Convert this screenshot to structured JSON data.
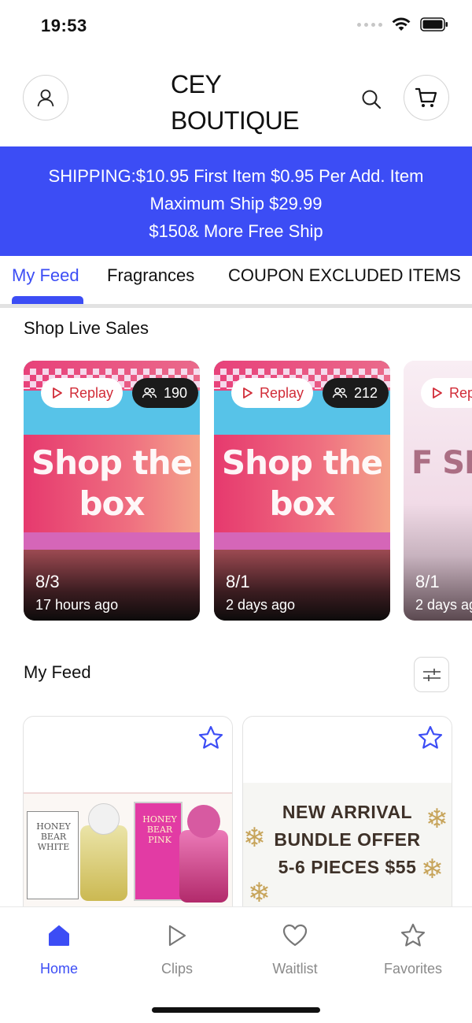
{
  "status_bar": {
    "time": "19:53"
  },
  "header": {
    "brand": "CEY\nBOUTIQUE"
  },
  "banner": {
    "lines": [
      "SHIPPING:$10.95 First Item $0.95  Per Add. Item",
      "Maximum Ship $29.99",
      "$150& More Free Ship"
    ],
    "background": "#3c4df5"
  },
  "tabs": [
    {
      "label": "My Feed",
      "active": true
    },
    {
      "label": "Fragrances",
      "active": false
    },
    {
      "label": "COUPON EXCLUDED ITEMS",
      "active": false
    }
  ],
  "live_section": {
    "title": "Shop Live Sales",
    "cards": [
      {
        "replay": "Replay",
        "viewers": "190",
        "headline": "Shop the box",
        "date": "8/3",
        "ago": "17 hours ago"
      },
      {
        "replay": "Replay",
        "viewers": "212",
        "headline": "Shop the box",
        "date": "8/1",
        "ago": "2 days ago"
      },
      {
        "replay": "Rep",
        "headline": "F SHI",
        "date": "8/1",
        "ago": "2 days ag"
      }
    ]
  },
  "feed_section": {
    "title": "My Feed",
    "products": [
      {
        "box_labels": [
          "HONEY BEAR WHITE",
          "HONEY BEAR PINK"
        ]
      },
      {
        "lines": [
          "NEW ARRIVAL",
          "BUNDLE OFFER",
          "5-6 PIECES $55"
        ]
      }
    ]
  },
  "bottom_nav": [
    {
      "label": "Home",
      "icon": "home-icon",
      "active": true
    },
    {
      "label": "Clips",
      "icon": "play-icon",
      "active": false
    },
    {
      "label": "Waitlist",
      "icon": "heart-icon",
      "active": false
    },
    {
      "label": "Favorites",
      "icon": "star-icon",
      "active": false
    }
  ],
  "colors": {
    "accent": "#3c4df5",
    "replay_red": "#d12b37"
  }
}
